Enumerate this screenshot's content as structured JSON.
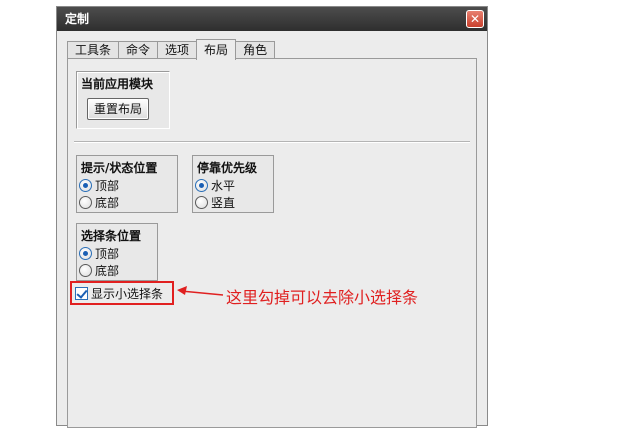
{
  "window": {
    "title": "定制",
    "close_symbol": "✕"
  },
  "tabs": [
    {
      "label": "工具条",
      "active": false
    },
    {
      "label": "命令",
      "active": false
    },
    {
      "label": "选项",
      "active": false
    },
    {
      "label": "布局",
      "active": true
    },
    {
      "label": "角色",
      "active": false
    }
  ],
  "current_module": {
    "title": "当前应用模块",
    "reset_button": "重置布局"
  },
  "tip_status": {
    "title": "提示/状态位置",
    "options": [
      {
        "label": "顶部",
        "checked": true
      },
      {
        "label": "底部",
        "checked": false
      }
    ]
  },
  "dock_priority": {
    "title": "停靠优先级",
    "options": [
      {
        "label": "水平",
        "checked": true
      },
      {
        "label": "竖直",
        "checked": false
      }
    ]
  },
  "selection_bar": {
    "title": "选择条位置",
    "options": [
      {
        "label": "顶部",
        "checked": true
      },
      {
        "label": "底部",
        "checked": false
      }
    ]
  },
  "show_mini_selection": {
    "label": "显示小选择条",
    "checked": true
  },
  "annotation": {
    "text": "这里勾掉可以去除小选择条",
    "color": "#e02020"
  },
  "colors": {
    "accent": "#1a5fb4",
    "highlight_box": "#e12020",
    "titlebar": "#3a3a3a"
  },
  "icons": {
    "close": "close-icon",
    "arrow": "arrow-left-icon"
  }
}
